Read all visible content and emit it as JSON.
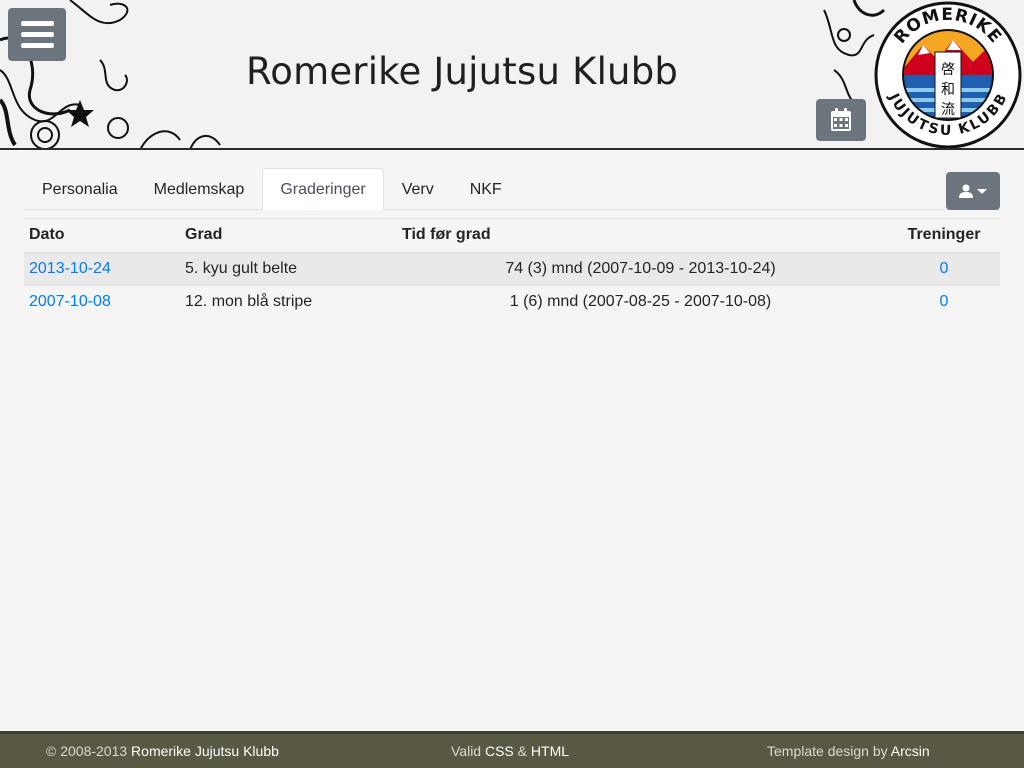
{
  "header": {
    "title": "Romerike Jujutsu Klubb",
    "menu_icon": "hamburger-icon",
    "calendar_icon": "calendar-icon",
    "logo": {
      "top_text": "ROMERIKE",
      "bottom_text": "JUJUTSU KLUBB",
      "kanji": [
        "啓",
        "和",
        "流"
      ]
    }
  },
  "tabs": [
    {
      "label": "Personalia",
      "active": false
    },
    {
      "label": "Medlemskap",
      "active": false
    },
    {
      "label": "Graderinger",
      "active": true
    },
    {
      "label": "Verv",
      "active": false
    },
    {
      "label": "NKF",
      "active": false
    }
  ],
  "user_menu": {
    "icon": "user-icon"
  },
  "table": {
    "headers": {
      "dato": "Dato",
      "grad": "Grad",
      "tid": "Tid før grad",
      "treninger": "Treninger"
    },
    "rows": [
      {
        "dato": "2013-10-24",
        "grad": "5. kyu gult belte",
        "tid": "74 (3) mnd (2007-10-09 - 2013-10-24)",
        "treninger": "0"
      },
      {
        "dato": "2007-10-08",
        "grad": "12. mon blå stripe",
        "tid": "1 (6) mnd (2007-08-25 - 2007-10-08)",
        "treninger": "0"
      }
    ]
  },
  "footer": {
    "copyright_prefix": "© 2008-2013",
    "club_name": "Romerike Jujutsu Klubb",
    "valid_prefix": "Valid",
    "css": "CSS",
    "amp": "&",
    "html": "HTML",
    "design_prefix": "Template design by",
    "designer": "Arcsin"
  },
  "colors": {
    "button_gray": "#6c757d",
    "link_blue": "#007bff",
    "footer_bg": "#595943",
    "header_bg": "#f2f2f2"
  }
}
